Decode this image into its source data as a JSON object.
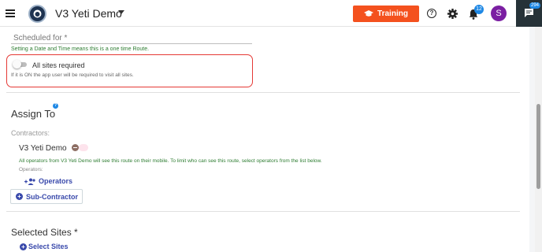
{
  "header": {
    "app_title": "V3 Yeti Demo",
    "training_label": "Training",
    "notifications_count": "12",
    "avatar_initial": "S",
    "chat_count": "294"
  },
  "form": {
    "scheduled_label": "Scheduled for  *",
    "scheduled_help": "Setting a Date and Time means this is a one time Route.",
    "toggle_label": "All sites required",
    "toggle_state": "off",
    "toggle_help": "If it is ON the app user will be required to visit all sites."
  },
  "assign": {
    "title": "Assign To",
    "contractors_label": "Contractors:",
    "contractor_name": "V3 Yeti Demo",
    "operators_notice": "All operators from V3 Yeti Demo will see this route on their mobile. To limit who can see this route, select operators from the list below.",
    "operators_sub": "Operators:",
    "operators_button": "Operators",
    "subcontractor_button": "Sub-Contractor"
  },
  "sites": {
    "title": "Selected Sites *",
    "select_button": "Select Sites"
  },
  "colors": {
    "accent": "#f4511e",
    "primary": "#3949ab",
    "highlight": "#e53935",
    "success_text": "#2e7d32"
  }
}
